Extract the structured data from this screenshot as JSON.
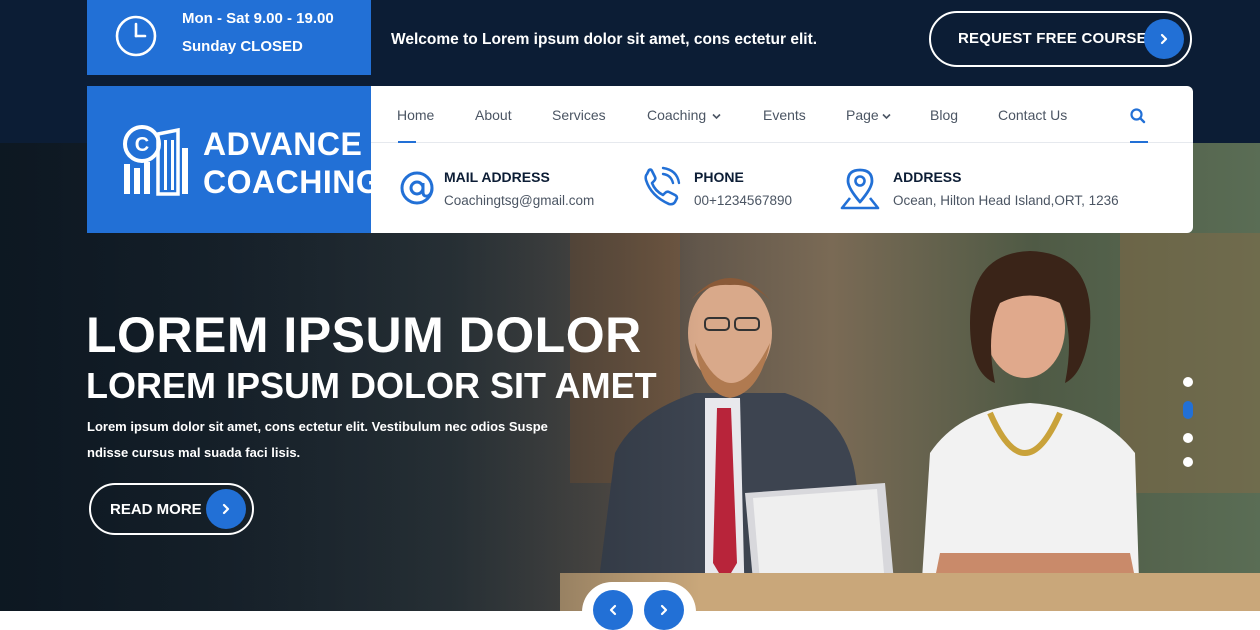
{
  "topbar": {
    "hours_line1": "Mon - Sat 9.00 - 19.00",
    "hours_line2": "Sunday CLOSED",
    "welcome": "Welcome to Lorem ipsum dolor sit amet, cons ectetur elit.",
    "request_button": "REQUEST FREE COURSE"
  },
  "logo": {
    "line1": "ADVANCE",
    "line2": "COACHING"
  },
  "nav": {
    "items": [
      "Home",
      "About",
      "Services",
      "Coaching",
      "Events",
      "Page",
      "Blog",
      "Contact Us"
    ],
    "active": "Home"
  },
  "contact": {
    "mail_title": "MAIL ADDRESS",
    "mail_value": "Coachingtsg@gmail.com",
    "phone_title": "PHONE",
    "phone_value": "00+1234567890",
    "address_title": "ADDRESS",
    "address_value": "Ocean, Hilton Head Island,ORT, 1236"
  },
  "hero": {
    "heading1": "LOREM IPSUM DOLOR",
    "heading2": "LOREM IPSUM DOLOR SIT AMET",
    "desc_line1": "Lorem ipsum dolor sit amet, cons ectetur elit. Vestibulum nec odios Suspe",
    "desc_line2": "ndisse cursus mal suada faci lisis.",
    "read_more": "READ MORE",
    "slide_count": 4,
    "active_slide": 2
  },
  "colors": {
    "accent": "#2270d6",
    "dark": "#0c1d35",
    "white": "#ffffff"
  },
  "icons": {
    "clock": "clock-icon",
    "chevron_right": "chevron-right-icon",
    "chevron_left": "chevron-left-icon",
    "chevron_down": "chevron-down-icon",
    "search": "search-icon",
    "mail": "at-icon",
    "phone": "phone-icon",
    "address": "map-pin-icon"
  }
}
